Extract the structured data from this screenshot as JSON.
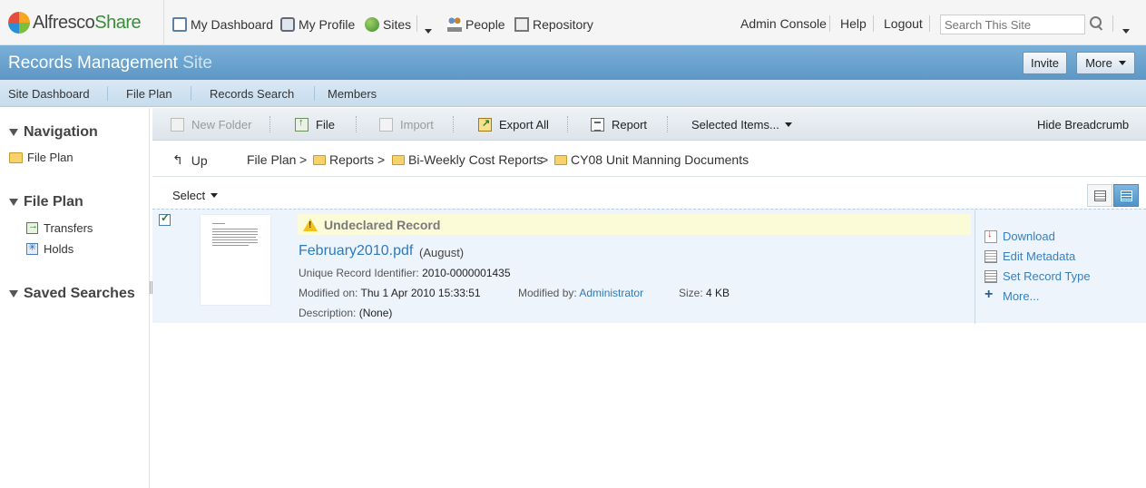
{
  "header": {
    "logo_text_a": "Alfresco",
    "logo_text_b": "Share",
    "nav": [
      {
        "label": "My Dashboard",
        "icon": "dashboard-icon"
      },
      {
        "label": "My Profile",
        "icon": "profile-icon"
      },
      {
        "label": "Sites",
        "icon": "sites-icon"
      },
      {
        "label": "People",
        "icon": "people-icon"
      },
      {
        "label": "Repository",
        "icon": "repository-icon"
      }
    ],
    "links": {
      "admin": "Admin Console",
      "help": "Help",
      "logout": "Logout"
    },
    "search_placeholder": "Search This Site"
  },
  "site": {
    "title": "Records Management",
    "title_suffix": "Site",
    "invite_label": "Invite",
    "more_label": "More"
  },
  "site_nav": [
    "Site Dashboard",
    "File Plan",
    "Records Search",
    "Members"
  ],
  "left_panel": {
    "navigation_title": "Navigation",
    "navigation_item": "File Plan",
    "fileplan_title": "File Plan",
    "fileplan_items": [
      "Transfers",
      "Holds"
    ],
    "saved_searches_title": "Saved Searches"
  },
  "toolbar": {
    "new_folder": "New Folder",
    "file": "File",
    "import": "Import",
    "export_all": "Export All",
    "report": "Report",
    "selected_items": "Selected Items...",
    "hide_breadcrumb": "Hide Breadcrumb"
  },
  "breadcrumb": {
    "up": "Up",
    "root": "File Plan",
    "path": [
      "Reports",
      "Bi-Weekly Cost Reports",
      "CY08 Unit Manning Documents"
    ],
    "separator": ">"
  },
  "select_label": "Select",
  "record": {
    "status": "Undeclared Record",
    "name": "February2010.pdf",
    "version": "(August)",
    "uri_label": "Unique Record Identifier:",
    "uri": "2010-0000001435",
    "modified_on_label": "Modified on:",
    "modified_on": "Thu 1 Apr 2010 15:33:51",
    "modified_by_label": "Modified by:",
    "modified_by": "Administrator",
    "size_label": "Size:",
    "size": "4 KB",
    "description_label": "Description:",
    "description": "(None)",
    "selected": true
  },
  "record_actions": [
    "Download",
    "Edit Metadata",
    "Set Record Type",
    "More..."
  ],
  "colors": {
    "accent": "#5e97c6",
    "link": "#2b7bc0",
    "undeclared_bg": "#fbfbd8"
  }
}
